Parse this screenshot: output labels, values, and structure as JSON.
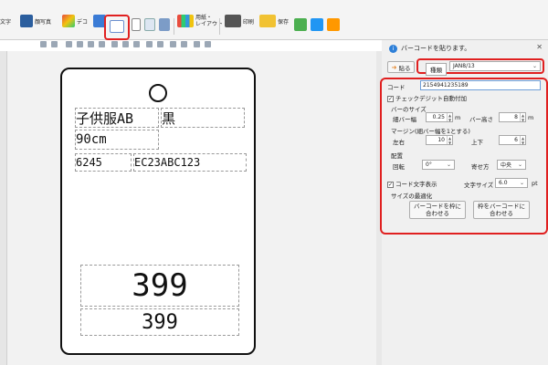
{
  "toolbar": {
    "text_label": "文字",
    "photo_label": "顔写真",
    "deco_label": "デコ",
    "paper_label": "用紙・\nレイアウト",
    "print_label": "印刷",
    "save_label": "保存"
  },
  "canvas": {
    "fields": {
      "product_name": "子供服AB",
      "color": "黒",
      "size": "90cm",
      "number": "6245",
      "code": "EC23ABC123",
      "price_big": "399",
      "price_small": "399"
    }
  },
  "panel": {
    "title": "バーコードを貼ります。",
    "paste_button": "貼る",
    "type_label": "種類",
    "type_value": "JAN8/13",
    "code_label": "コード",
    "code_value": "2154941235189",
    "check_digit_label": "チェックデジット自動付加",
    "bar_size_label": "バーのサイズ",
    "narrow_bar_label": "細バー幅",
    "narrow_bar_value": "0.25",
    "narrow_bar_unit": "m",
    "bar_height_label": "バー高さ",
    "bar_height_value": "8",
    "bar_height_unit": "m",
    "margin_label": "マージン(細バー幅を1とする)",
    "lr_label": "左右",
    "lr_value": "10",
    "tb_label": "上下",
    "tb_value": "6",
    "layout_label": "配置",
    "rotate_label": "回転",
    "rotate_value": "0°",
    "align_label": "寄せ方",
    "align_value": "中央",
    "show_text_label": "コード文字表示",
    "font_size_label": "文字サイズ",
    "font_size_value": "6.0",
    "font_size_unit": "pt",
    "optimize_label": "サイズの最適化",
    "fit_width_button_line1": "バーコードを枠に",
    "fit_width_button_line2": "合わせる",
    "fit_frame_button_line1": "枠をバーコードに",
    "fit_frame_button_line2": "合わせる"
  },
  "colors": {
    "highlight": "#e02020",
    "accent_blue": "#2d7fd8",
    "orange": "#e4862b"
  }
}
